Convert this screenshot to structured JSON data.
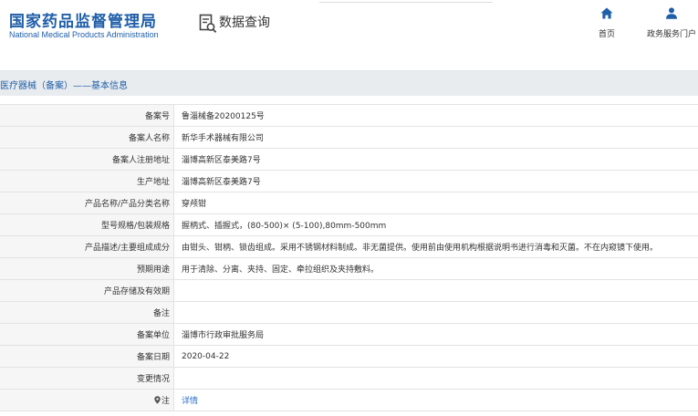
{
  "header": {
    "logo_cn": "国家药品监督管理局",
    "logo_en": "National Medical Products Administration",
    "query_title": "数据查询",
    "nav_home": "首页",
    "nav_portal": "政务服务门户"
  },
  "breadcrumb": "医疗器械（备案）——基本信息",
  "rows": [
    {
      "label": "备案号",
      "value": "鲁淄械备20200125号"
    },
    {
      "label": "备案人名称",
      "value": "新华手术器械有限公司"
    },
    {
      "label": "备案人注册地址",
      "value": "淄博高新区泰美路7号"
    },
    {
      "label": "生产地址",
      "value": "淄博高新区泰美路7号"
    },
    {
      "label": "产品名称/产品分类名称",
      "value": "穿颅钳"
    },
    {
      "label": "型号规格/包装规格",
      "value": "握柄式、插握式，(80-500)× (5-100),80mm-500mm"
    },
    {
      "label": "产品描述/主要组成成分",
      "value": "由钳头、钳柄、锁齿组成。采用不锈钢材料制成。非无菌提供。使用前由使用机构根据说明书进行消毒和灭菌。不在内窥镜下使用。"
    },
    {
      "label": "预期用途",
      "value": "用于清除、分离、夹持、固定、牵拉组织及夹持敷料。"
    },
    {
      "label": "产品存储及有效期",
      "value": ""
    },
    {
      "label": "备注",
      "value": ""
    },
    {
      "label": "备案单位",
      "value": "淄博市行政审批服务局"
    },
    {
      "label": "备案日期",
      "value": "2020-04-22"
    },
    {
      "label": "变更情况",
      "value": ""
    }
  ],
  "note": {
    "label": "注",
    "link": "详情"
  },
  "icons": {
    "search": "data-search-icon",
    "home": "home-icon",
    "user": "user-icon",
    "pin": "location-pin-icon"
  },
  "colors": {
    "brand": "#1f5ea8",
    "link": "#2a6fc9",
    "label_bg": "#f6f6f6",
    "crumb_bg": "#e9ecef"
  }
}
